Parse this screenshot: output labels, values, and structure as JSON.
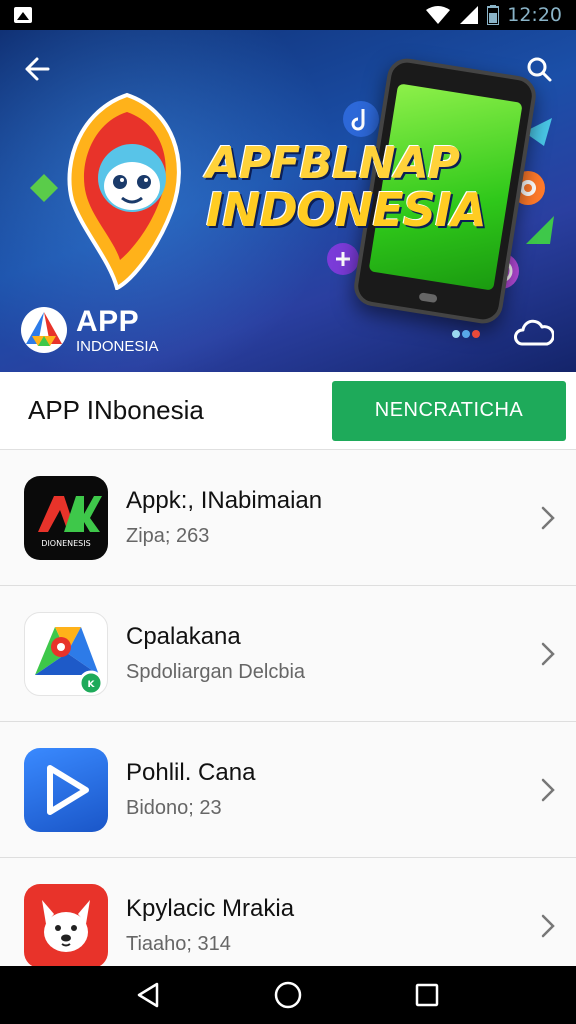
{
  "status_bar": {
    "time": "12:20",
    "icons": [
      "image-icon",
      "wifi-icon",
      "signal-icon",
      "battery-icon"
    ]
  },
  "hero": {
    "title_line1": "APFBLNAP",
    "title_line2": "INDONESIA",
    "logo_big": "APP",
    "logo_small": "INDONESIA",
    "background_color": "#1b4fa8",
    "title_color": "#ffd23a",
    "icons": [
      "back-arrow-icon",
      "search-icon",
      "cloud-icon"
    ]
  },
  "header": {
    "title": "APP INbonesia",
    "button_label": "NENCRATICHA",
    "button_color": "#1eaa5a"
  },
  "apps": [
    {
      "name": "Appk:, INabimaian",
      "sub": "Zipa; 263",
      "icon": "ak-logo-icon"
    },
    {
      "name": "Cpalakana",
      "sub": "Spdoliargan Delcbia",
      "icon": "maps-icon"
    },
    {
      "name": "Pohlil. Cana",
      "sub": "Bidono; 23",
      "icon": "play-icon"
    },
    {
      "name": "Kpylacic Mrakia",
      "sub": "Tiaaho; 314",
      "icon": "dog-face-icon"
    }
  ],
  "nav": {
    "icons": [
      "back-triangle-icon",
      "home-circle-icon",
      "recents-square-icon"
    ]
  }
}
